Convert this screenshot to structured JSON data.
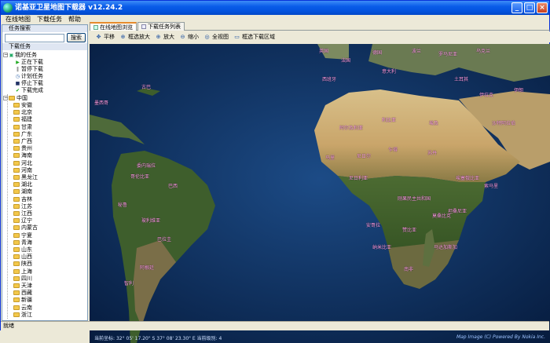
{
  "window": {
    "title": "诺基亚卫星地图下载器 v12.24.2",
    "buttons": {
      "minimize": "_",
      "maximize": "□",
      "close": "×"
    }
  },
  "menu": {
    "items": [
      "在线地图",
      "下载任务",
      "帮助"
    ]
  },
  "sidebar": {
    "search_header": "任务搜索",
    "search_placeholder": "",
    "search_button": "搜索",
    "tasks_header": "下载任务",
    "my_tasks": "我的任务",
    "task_states": [
      "正在下载",
      "暂停下载",
      "计划任务",
      "停止下载",
      "下载完成"
    ],
    "region_root": "中国",
    "provinces": [
      "安徽",
      "北京",
      "福建",
      "甘肃",
      "广东",
      "广西",
      "贵州",
      "海南",
      "河北",
      "河南",
      "黑龙江",
      "湖北",
      "湖南",
      "吉林",
      "江苏",
      "江西",
      "辽宁",
      "内蒙古",
      "宁夏",
      "青海",
      "山东",
      "山西",
      "陕西",
      "上海",
      "四川",
      "天津",
      "西藏",
      "新疆",
      "云南",
      "浙江",
      "重庆"
    ]
  },
  "tabs": [
    {
      "label": "在线地图浏览",
      "active": true
    },
    {
      "label": "下载任务列表",
      "active": false
    }
  ],
  "toolbar": {
    "pan": "平移",
    "box_zoom_in": "框选放大",
    "zoom_in": "放大",
    "zoom_out": "缩小",
    "full_view": "全视图",
    "box_select_download": "框选下载区域"
  },
  "map": {
    "labels": {
      "eg": "埃及",
      "ly": "利比亚",
      "dz": "阿尔及利亚",
      "ml": "马里",
      "ne": "尼日尔",
      "td": "乍得",
      "sd": "苏丹",
      "ng": "尼日利亚",
      "et": "埃塞俄比亚",
      "so": "索马里",
      "cd": "刚果民主共和国",
      "tz": "坦桑尼亚",
      "ao": "安哥拉",
      "zm": "赞比亚",
      "mz": "莫桑比克",
      "mg": "马达加斯加",
      "na": "纳米比亚",
      "za": "南非",
      "sa": "沙特阿拉伯",
      "iq": "伊拉克",
      "ir": "伊朗",
      "tr": "土耳其",
      "ro": "罗马尼亚",
      "ua": "乌克兰",
      "fr": "法国",
      "de": "德国",
      "es": "西班牙",
      "it": "意大利",
      "pl": "波兰",
      "uk": "英国",
      "br": "巴西",
      "ve": "委内瑞拉",
      "co": "哥伦比亚",
      "pe": "秘鲁",
      "bo": "玻利维亚",
      "ar": "阿根廷",
      "cl": "智利",
      "py": "巴拉圭",
      "mx": "墨西哥",
      "cu": "古巴"
    },
    "coord_label": "当前坐标:",
    "coord_value": "32° 05' 17.20\" S  37° 08' 23.30\" E",
    "zoom_label": "当前级别:",
    "zoom_value": "4",
    "credit": "Map Image (C) Powered By Nokia Inc."
  },
  "status": {
    "text": "就绪"
  },
  "colors": {
    "title_bar": "#0454e0",
    "label": "#ff9de6",
    "ocean": "#0b2a55"
  }
}
